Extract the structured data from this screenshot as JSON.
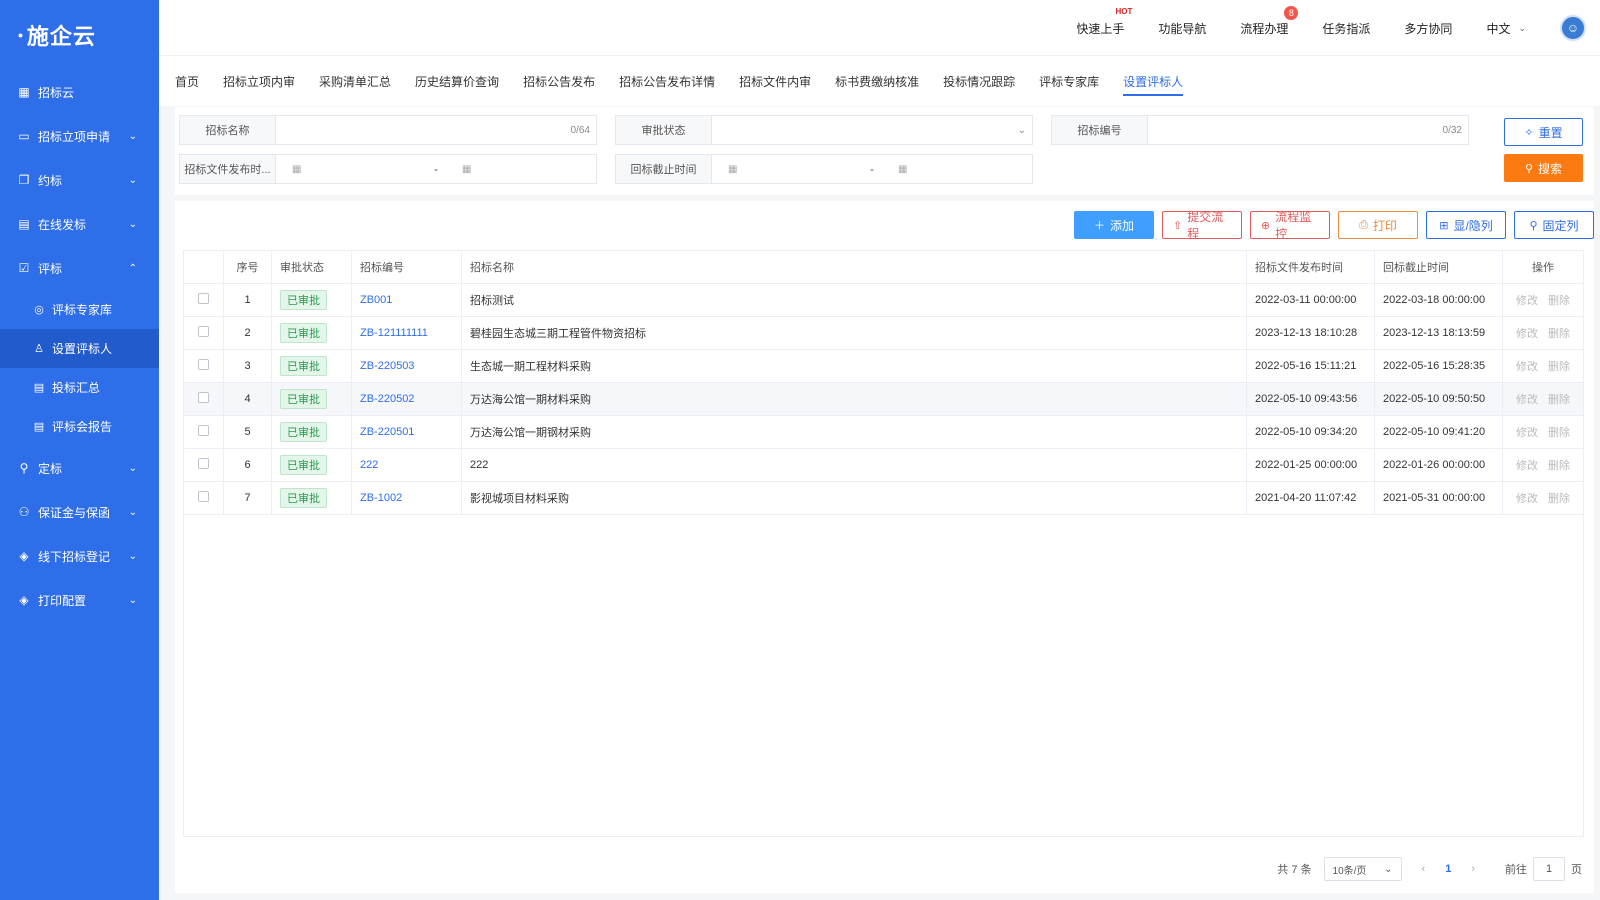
{
  "app": {
    "logo": "施企云"
  },
  "sidebar": {
    "items": [
      {
        "label": "招标云",
        "icon": "grid-icon"
      },
      {
        "label": "招标立项申请",
        "icon": "folder-icon"
      },
      {
        "label": "约标",
        "icon": "copy-icon"
      },
      {
        "label": "在线发标",
        "icon": "document-icon"
      },
      {
        "label": "评标",
        "icon": "checklist-icon"
      },
      {
        "label": "定标",
        "icon": "stamp-icon"
      },
      {
        "label": "保证金与保函",
        "icon": "network-icon"
      },
      {
        "label": "线下招标登记",
        "icon": "layers-icon"
      },
      {
        "label": "打印配置",
        "icon": "layers-icon"
      }
    ],
    "sub_items": [
      {
        "label": "评标专家库",
        "icon": "badge-icon"
      },
      {
        "label": "设置评标人",
        "icon": "user-icon"
      },
      {
        "label": "投标汇总",
        "icon": "doc-icon"
      },
      {
        "label": "评标会报告",
        "icon": "doc-icon"
      }
    ]
  },
  "header": {
    "nav": [
      "快速上手",
      "功能导航",
      "流程办理",
      "任务指派",
      "多方协同"
    ],
    "hot_label": "HOT",
    "badge_count": "8",
    "language": "中文"
  },
  "tabs": [
    "首页",
    "招标立项内审",
    "采购清单汇总",
    "历史结算价查询",
    "招标公告发布",
    "招标公告发布详情",
    "招标文件内审",
    "标书费缴纳核准",
    "投标情况跟踪",
    "评标专家库",
    "设置评标人"
  ],
  "active_tab": "设置评标人",
  "filters": {
    "name_label": "招标名称",
    "name_count": "0/64",
    "status_label": "审批状态",
    "code_label": "招标编号",
    "code_count": "0/32",
    "publish_label": "招标文件发布时...",
    "deadline_label": "回标截止时间",
    "date_sep": "-",
    "reset": "重置",
    "search": "搜索"
  },
  "toolbar": {
    "add": "添加",
    "submit": "提交流程",
    "monitor": "流程监控",
    "print": "打印",
    "columns": "显/隐列",
    "pin": "固定列"
  },
  "table": {
    "headers": [
      "序号",
      "审批状态",
      "招标编号",
      "招标名称",
      "招标文件发布时间",
      "回标截止时间",
      "操作"
    ],
    "rows": [
      {
        "idx": "1",
        "status": "已审批",
        "code": "ZB001",
        "name": "招标测试",
        "publish": "2022-03-11 00:00:00",
        "deadline": "2022-03-18 00:00:00"
      },
      {
        "idx": "2",
        "status": "已审批",
        "code": "ZB-121111111",
        "name": "碧桂园生态城三期工程管件物资招标",
        "publish": "2023-12-13 18:10:28",
        "deadline": "2023-12-13 18:13:59"
      },
      {
        "idx": "3",
        "status": "已审批",
        "code": "ZB-220503",
        "name": "生态城一期工程材料采购",
        "publish": "2022-05-16 15:11:21",
        "deadline": "2022-05-16 15:28:35"
      },
      {
        "idx": "4",
        "status": "已审批",
        "code": "ZB-220502",
        "name": "万达海公馆一期材料采购",
        "publish": "2022-05-10 09:43:56",
        "deadline": "2022-05-10 09:50:50"
      },
      {
        "idx": "5",
        "status": "已审批",
        "code": "ZB-220501",
        "name": "万达海公馆一期钢材采购",
        "publish": "2022-05-10 09:34:20",
        "deadline": "2022-05-10 09:41:20"
      },
      {
        "idx": "6",
        "status": "已审批",
        "code": "222",
        "name": "222",
        "publish": "2022-01-25 00:00:00",
        "deadline": "2022-01-26 00:00:00"
      },
      {
        "idx": "7",
        "status": "已审批",
        "code": "ZB-1002",
        "name": "影视城项目材料采购",
        "publish": "2021-04-20 11:07:42",
        "deadline": "2021-05-31 00:00:00"
      }
    ],
    "op_edit": "修改",
    "op_delete": "删除"
  },
  "pagination": {
    "total": "共 7 条",
    "page_size": "10条/页",
    "current": "1",
    "goto_prefix": "前往",
    "goto_value": "1",
    "goto_suffix": "页"
  }
}
